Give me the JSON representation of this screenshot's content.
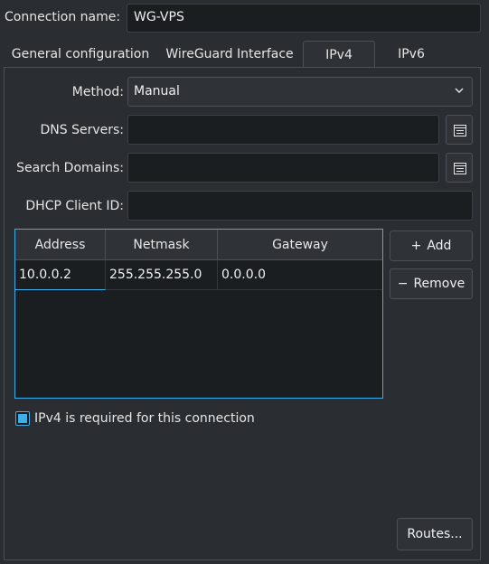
{
  "connection": {
    "label": "Connection name:",
    "value": "WG-VPS"
  },
  "tabs": [
    {
      "label": "General configuration",
      "active": false
    },
    {
      "label": "WireGuard Interface",
      "active": false
    },
    {
      "label": "IPv4",
      "active": true
    },
    {
      "label": "IPv6",
      "active": false
    }
  ],
  "form": {
    "method_label": "Method:",
    "method_value": "Manual",
    "dns_label": "DNS Servers:",
    "dns_value": "",
    "search_label": "Search Domains:",
    "search_value": "",
    "dhcp_label": "DHCP Client ID:",
    "dhcp_value": ""
  },
  "table": {
    "headers": [
      "Address",
      "Netmask",
      "Gateway"
    ],
    "rows": [
      [
        "10.0.0.2",
        "255.255.255.0",
        "0.0.0.0"
      ]
    ]
  },
  "buttons": {
    "add_label": "Add",
    "remove_label": "Remove",
    "routes_label": "Routes..."
  },
  "ipv4_required": {
    "label": "IPv4 is required for this connection",
    "checked": true
  },
  "icons": {
    "dropdown": "chevron-down-icon",
    "list_editor": "list-edit-icon",
    "add": "plus-icon",
    "remove": "minus-icon"
  },
  "colors": {
    "accent": "#3daee9",
    "background": "#2a2e32",
    "field": "#1b1e20"
  }
}
